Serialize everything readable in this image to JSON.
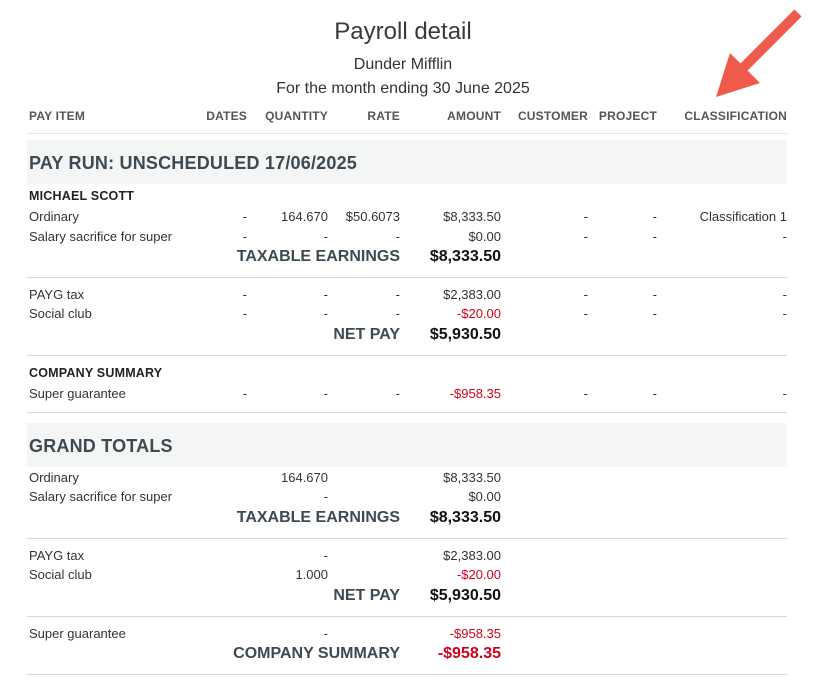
{
  "report": {
    "title": "Payroll detail",
    "company": "Dunder Mifflin",
    "period": "For the month ending 30 June 2025"
  },
  "columns": {
    "pay_item": "PAY ITEM",
    "dates": "DATES",
    "quantity": "QUANTITY",
    "rate": "RATE",
    "amount": "AMOUNT",
    "customer": "CUSTOMER",
    "project": "PROJECT",
    "classification": "CLASSIFICATION"
  },
  "pay_run": {
    "heading": "PAY RUN: UNSCHEDULED 17/06/2025",
    "employee": "MICHAEL SCOTT",
    "earnings": [
      {
        "item": "Ordinary",
        "dates": "-",
        "quantity": "164.670",
        "rate": "$50.6073",
        "amount": "$8,333.50",
        "customer": "-",
        "project": "-",
        "classification": "Classification 1"
      },
      {
        "item": "Salary sacrifice for super",
        "dates": "-",
        "quantity": "-",
        "rate": "-",
        "amount": "$0.00",
        "customer": "-",
        "project": "-",
        "classification": "-"
      }
    ],
    "taxable_label": "TAXABLE EARNINGS",
    "taxable_amount": "$8,333.50",
    "deductions": [
      {
        "item": "PAYG tax",
        "dates": "-",
        "quantity": "-",
        "rate": "-",
        "amount": "$2,383.00",
        "customer": "-",
        "project": "-",
        "classification": "-"
      },
      {
        "item": "Social club",
        "dates": "-",
        "quantity": "-",
        "rate": "-",
        "amount": "-$20.00",
        "customer": "-",
        "project": "-",
        "classification": "-"
      }
    ],
    "net_label": "NET PAY",
    "net_amount": "$5,930.50",
    "company_summary_heading": "COMPANY SUMMARY",
    "company_items": [
      {
        "item": "Super guarantee",
        "dates": "-",
        "quantity": "-",
        "rate": "-",
        "amount": "-$958.35",
        "customer": "-",
        "project": "-",
        "classification": "-"
      }
    ]
  },
  "grand_totals": {
    "heading": "GRAND TOTALS",
    "earnings": [
      {
        "item": "Ordinary",
        "quantity": "164.670",
        "amount": "$8,333.50"
      },
      {
        "item": "Salary sacrifice for super",
        "quantity": "-",
        "amount": "$0.00"
      }
    ],
    "taxable_label": "TAXABLE EARNINGS",
    "taxable_amount": "$8,333.50",
    "deductions": [
      {
        "item": "PAYG tax",
        "quantity": "-",
        "amount": "$2,383.00"
      },
      {
        "item": "Social club",
        "quantity": "1.000",
        "amount": "-$20.00"
      }
    ],
    "net_label": "NET PAY",
    "net_amount": "$5,930.50",
    "company_items": [
      {
        "item": "Super guarantee",
        "quantity": "-",
        "amount": "-$958.35"
      }
    ],
    "company_label": "COMPANY SUMMARY",
    "company_amount": "-$958.35"
  },
  "colors": {
    "negative": "#d0021b",
    "section_band": "#f4f5f5",
    "annotation_arrow": "#f05a4a"
  },
  "annotation": {
    "icon": "arrow-pointing-icon"
  }
}
